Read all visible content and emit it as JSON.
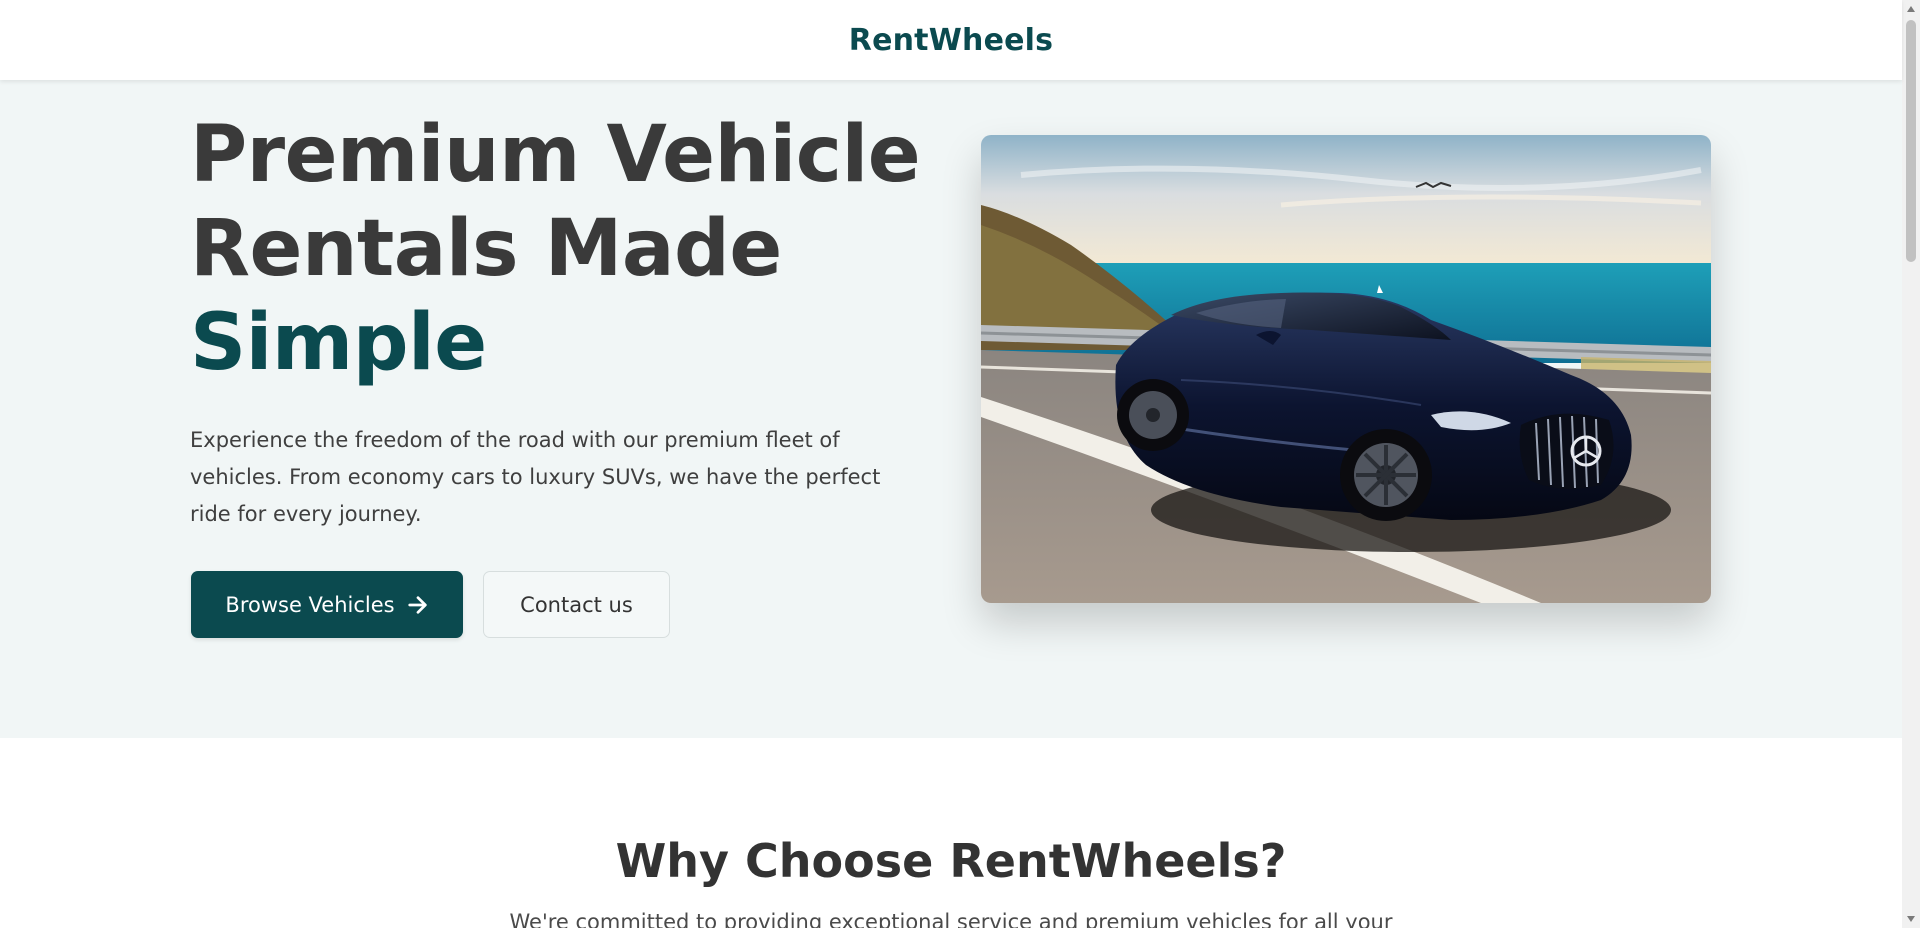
{
  "header": {
    "brand": "RentWheels"
  },
  "hero": {
    "title_line1": "Premium Vehicle",
    "title_line2": "Rentals Made",
    "title_accent": "Simple",
    "description": "Experience the freedom of the road with our premium fleet of vehicles. From economy cars to luxury SUVs, we have the perfect ride for every journey.",
    "primary_button": "Browse Vehicles",
    "primary_button_icon": "arrow-right-icon",
    "secondary_button": "Contact us",
    "image_subject": "car-photo"
  },
  "features": {
    "title": "Why Choose RentWheels?",
    "subtitle": "We're committed to providing exceptional service and premium vehicles for all your"
  },
  "colors": {
    "brand": "#0b4a4f",
    "hero_background": "#f1f6f6",
    "heading": "#3a3a3a"
  }
}
